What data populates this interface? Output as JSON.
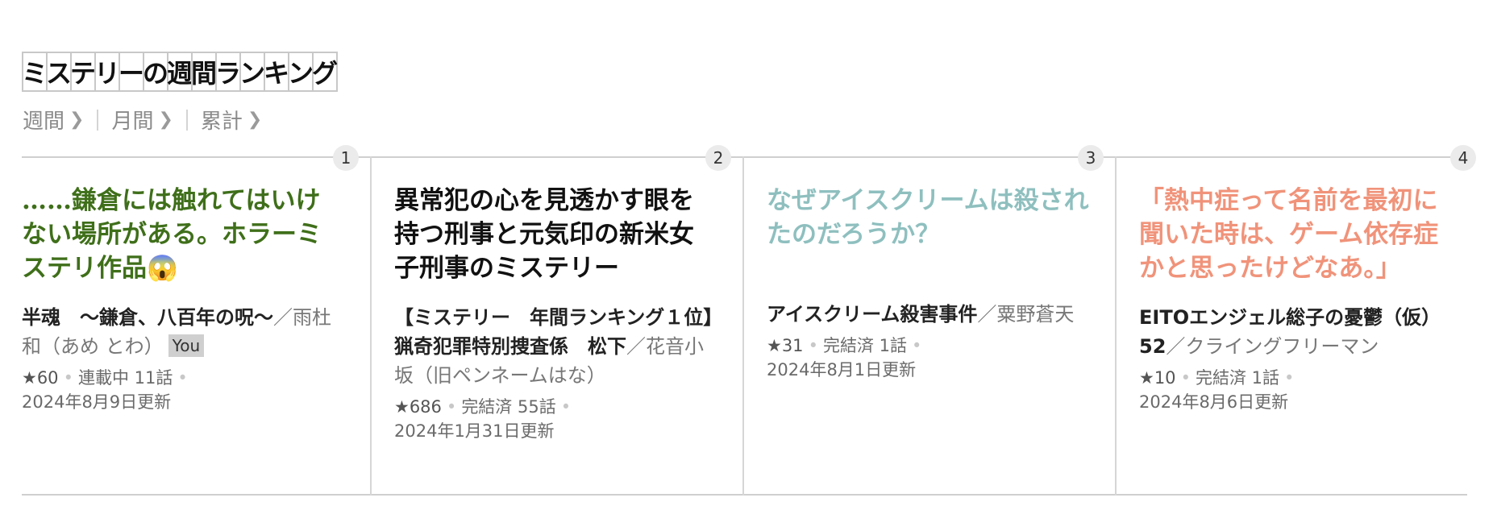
{
  "heading": {
    "title": "ミステリーの週間ランキング",
    "title_chars": [
      "ミ",
      "ス",
      "テ",
      "リ",
      "ー",
      "の",
      "週",
      "間",
      "ラ",
      "ン",
      "キ",
      "ン",
      "グ"
    ]
  },
  "tabs": [
    {
      "label": "週間",
      "icon": "chevron-right-icon"
    },
    {
      "label": "月間",
      "icon": "chevron-right-icon"
    },
    {
      "label": "累計",
      "icon": "chevron-right-icon"
    }
  ],
  "rankings": [
    {
      "rank": "1",
      "catchphrase": "……鎌倉には触れてはいけない場所がある。ホラーミステリ作品😱",
      "catch_color": "#3f6f1a",
      "title": "半魂　〜鎌倉、八百年の呪〜",
      "author": "／雨杜和（あめ とわ）",
      "badge": "You",
      "stars": "★60",
      "status": "連載中 11話",
      "updated": "2024年8月9日更新"
    },
    {
      "rank": "2",
      "catchphrase": "異常犯の心を見透かす眼を持つ刑事と元気印の新米女子刑事のミステリー",
      "catch_color": "#111111",
      "title": "【ミステリー　年間ランキング１位】猟奇犯罪特別捜査係　松下",
      "author": "／花音小坂（旧ペンネームはな）",
      "badge": "",
      "stars": "★686",
      "status": "完結済 55話",
      "updated": "2024年1月31日更新"
    },
    {
      "rank": "3",
      "catchphrase": "なぜアイスクリームは殺されたのだろうか？",
      "catch_color": "#8fbfbf",
      "title": "アイスクリーム殺害事件",
      "author": "／粟野蒼天",
      "badge": "",
      "stars": "★31",
      "status": "完結済 1話",
      "updated": "2024年8月1日更新"
    },
    {
      "rank": "4",
      "catchphrase": "「熱中症って名前を最初に聞いた時は、ゲーム依存症かと思ったけどなあ。」",
      "catch_color": "#f0937a",
      "title": "EITOエンジェル総子の憂鬱（仮）52",
      "author": "／クライングフリーマン",
      "badge": "",
      "stars": "★10",
      "status": "完結済 1話",
      "updated": "2024年8月6日更新"
    }
  ]
}
